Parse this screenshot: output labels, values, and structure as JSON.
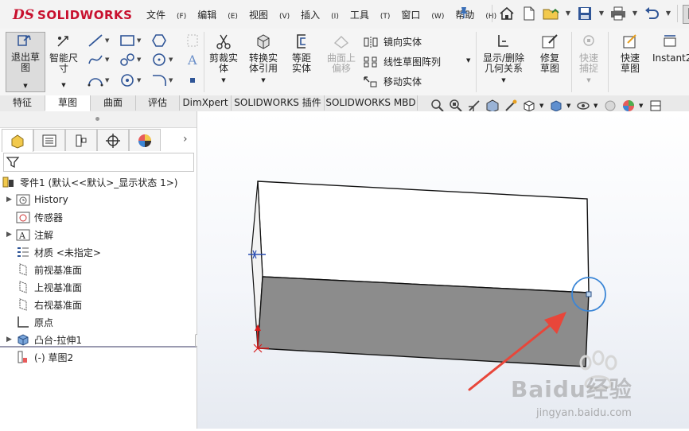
{
  "app": {
    "logo_ds": "DS",
    "logo_text": "SOLIDWORKS"
  },
  "menu": [
    {
      "label": "文件",
      "key": "(F)"
    },
    {
      "label": "编辑",
      "key": "(E)"
    },
    {
      "label": "视图",
      "key": "(V)"
    },
    {
      "label": "插入",
      "key": "(I)"
    },
    {
      "label": "工具",
      "key": "(T)"
    },
    {
      "label": "窗口",
      "key": "(W)"
    },
    {
      "label": "帮助",
      "key": "(H)"
    }
  ],
  "ribbon": {
    "exit_sketch": "退出草图",
    "smart_dim": "智能尺寸",
    "trim": "剪裁实体",
    "convert": "转换实体引用",
    "offset": "等距实体",
    "surface_offset": "曲面上偏移",
    "mirror": "镜向实体",
    "linear_pattern": "线性草图阵列",
    "move": "移动实体",
    "display_delete": "显示/删除几何关系",
    "repair": "修复草图",
    "quick_snap": "快速捕捉",
    "rapid_sketch": "快速草图",
    "instant2d": "Instant2"
  },
  "tabs": [
    "特征",
    "草图",
    "曲面",
    "评估",
    "DimXpert",
    "SOLIDWORKS 插件",
    "SOLIDWORKS MBD"
  ],
  "active_tab": "草图",
  "tree": {
    "root": "零件1 (默认<<默认>_显示状态 1>)",
    "items": [
      {
        "label": "History",
        "expand": true,
        "icon": "history-folder-icon"
      },
      {
        "label": "传感器",
        "expand": false,
        "icon": "sensor-icon"
      },
      {
        "label": "注解",
        "expand": true,
        "icon": "annotation-icon"
      },
      {
        "label": "材质 <未指定>",
        "expand": false,
        "icon": "material-icon"
      },
      {
        "label": "前视基准面",
        "expand": false,
        "icon": "plane-icon"
      },
      {
        "label": "上视基准面",
        "expand": false,
        "icon": "plane-icon"
      },
      {
        "label": "右视基准面",
        "expand": false,
        "icon": "plane-icon"
      },
      {
        "label": "原点",
        "expand": false,
        "icon": "origin-icon"
      },
      {
        "label": "凸台-拉伸1",
        "expand": true,
        "icon": "extrude-icon"
      },
      {
        "label": "(-) 草图2",
        "expand": false,
        "icon": "sketch-icon"
      }
    ]
  },
  "watermark": {
    "brand": "Baidu经验",
    "url": "jingyan.baidu.com"
  },
  "colors": {
    "accent": "#c8102e",
    "face_top": "#ffffff",
    "face_front": "#8c8c8c",
    "highlight": "#3b86d6",
    "arrow": "#e8463a"
  }
}
